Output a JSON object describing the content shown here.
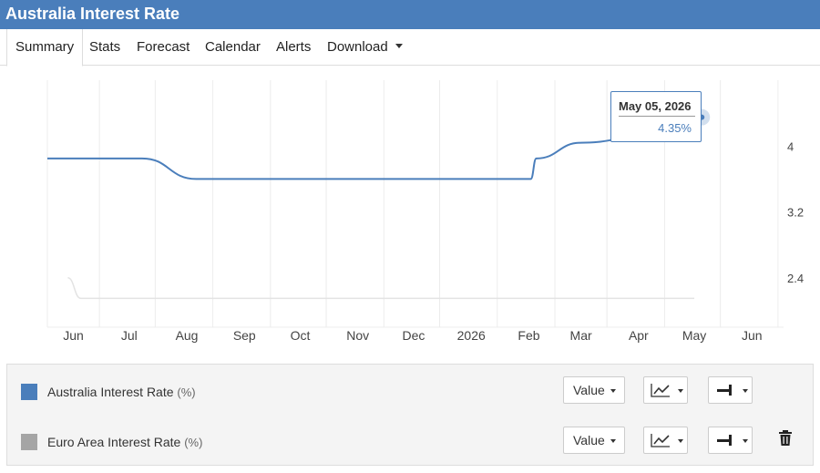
{
  "header": {
    "title": "Australia Interest Rate"
  },
  "tabs": [
    {
      "label": "Summary",
      "active": true
    },
    {
      "label": "Stats"
    },
    {
      "label": "Forecast"
    },
    {
      "label": "Calendar"
    },
    {
      "label": "Alerts"
    },
    {
      "label": "Download",
      "dropdown": true
    }
  ],
  "chart_data": {
    "type": "line",
    "title": "",
    "xlabel": "",
    "ylabel": "",
    "x_ticks": [
      "Jun",
      "Jul",
      "Aug",
      "Sep",
      "Oct",
      "Nov",
      "Dec",
      "2026",
      "Feb",
      "Mar",
      "Apr",
      "May",
      "Jun"
    ],
    "y_ticks": [
      2.4,
      3.2,
      4
    ],
    "ylim": [
      1.8,
      4.8
    ],
    "y_axis_side": "right",
    "grid": true,
    "series": [
      {
        "name": "Australia Interest Rate",
        "color": "#4a7ebb",
        "points": [
          [
            "2025-05-18",
            3.85
          ],
          [
            "2025-07-01",
            3.85
          ],
          [
            "2025-07-08",
            3.85
          ],
          [
            "2025-08-06",
            3.6
          ],
          [
            "2025-08-15",
            3.6
          ],
          [
            "2026-02-02",
            3.6
          ],
          [
            "2026-02-05",
            3.85
          ],
          [
            "2026-03-01",
            4.04
          ],
          [
            "2026-04-01",
            4.1
          ],
          [
            "2026-04-25",
            4.1
          ],
          [
            "2026-05-01",
            4.1
          ],
          [
            "2026-05-05",
            4.35
          ]
        ]
      },
      {
        "name": "Euro Area Interest Rate",
        "color": "#e3e3e3",
        "points": [
          [
            "2025-05-29",
            2.4
          ],
          [
            "2025-06-05",
            2.15
          ],
          [
            "2025-06-15",
            2.15
          ],
          [
            "2026-05-01",
            2.15
          ]
        ]
      }
    ],
    "tooltip": {
      "date": "May 05, 2026",
      "value": "4.35%"
    }
  },
  "legend": {
    "items": [
      {
        "name": "Australia Interest Rate",
        "unit": "(%)",
        "color": "#4a7ebb",
        "value_label": "Value",
        "deletable": false
      },
      {
        "name": "Euro Area Interest Rate",
        "unit": "(%)",
        "color": "#a5a5a5",
        "value_label": "Value",
        "deletable": true
      }
    ]
  }
}
